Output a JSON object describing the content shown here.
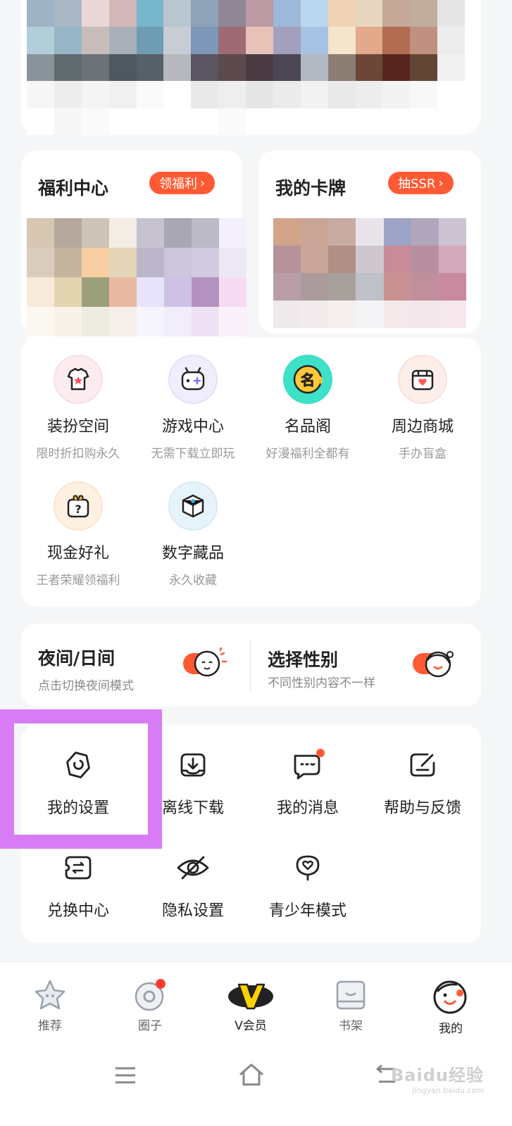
{
  "welfare": {
    "title": "福利中心",
    "button": "领福利"
  },
  "cards": {
    "title": "我的卡牌",
    "button": "抽SSR"
  },
  "functions": [
    {
      "title": "装扮空间",
      "subtitle": "限时折扣购永久",
      "icon": "tshirt-icon"
    },
    {
      "title": "游戏中心",
      "subtitle": "无需下载立即玩",
      "icon": "gamepad-icon"
    },
    {
      "title": "名品阁",
      "subtitle": "好漫福利全都有",
      "icon": "famous-badge-icon"
    },
    {
      "title": "周边商城",
      "subtitle": "手办盲盒",
      "icon": "shop-icon"
    },
    {
      "title": "现金好礼",
      "subtitle": "王者荣耀领福利",
      "icon": "gift-box-icon"
    },
    {
      "title": "数字藏品",
      "subtitle": "永久收藏",
      "icon": "digital-collectible-icon"
    }
  ],
  "toggles": {
    "night": {
      "title": "夜间/日间",
      "subtitle": "点击切换夜间模式"
    },
    "gender": {
      "title": "选择性别",
      "subtitle": "不同性别内容不一样"
    }
  },
  "tools": [
    {
      "label": "我的设置",
      "icon": "settings-gear-icon"
    },
    {
      "label": "离线下载",
      "icon": "download-icon"
    },
    {
      "label": "我的消息",
      "icon": "message-icon"
    },
    {
      "label": "帮助与反馈",
      "icon": "feedback-edit-icon"
    },
    {
      "label": "兑换中心",
      "icon": "exchange-ticket-icon"
    },
    {
      "label": "隐私设置",
      "icon": "eye-hidden-icon"
    },
    {
      "label": "青少年模式",
      "icon": "teen-mode-icon"
    }
  ],
  "tabs": [
    {
      "label": "推荐",
      "icon": "star-icon"
    },
    {
      "label": "圈子",
      "icon": "circle-icon"
    },
    {
      "label": "V会员",
      "icon": "vip-v-icon"
    },
    {
      "label": "书架",
      "icon": "bookshelf-icon"
    },
    {
      "label": "我的",
      "icon": "profile-face-icon"
    }
  ],
  "watermark": {
    "text": "Baidu经验",
    "sub": "jingyan.baidu.com"
  },
  "colors": {
    "accent": "#ff5a34",
    "highlight": "#d77cf5"
  }
}
